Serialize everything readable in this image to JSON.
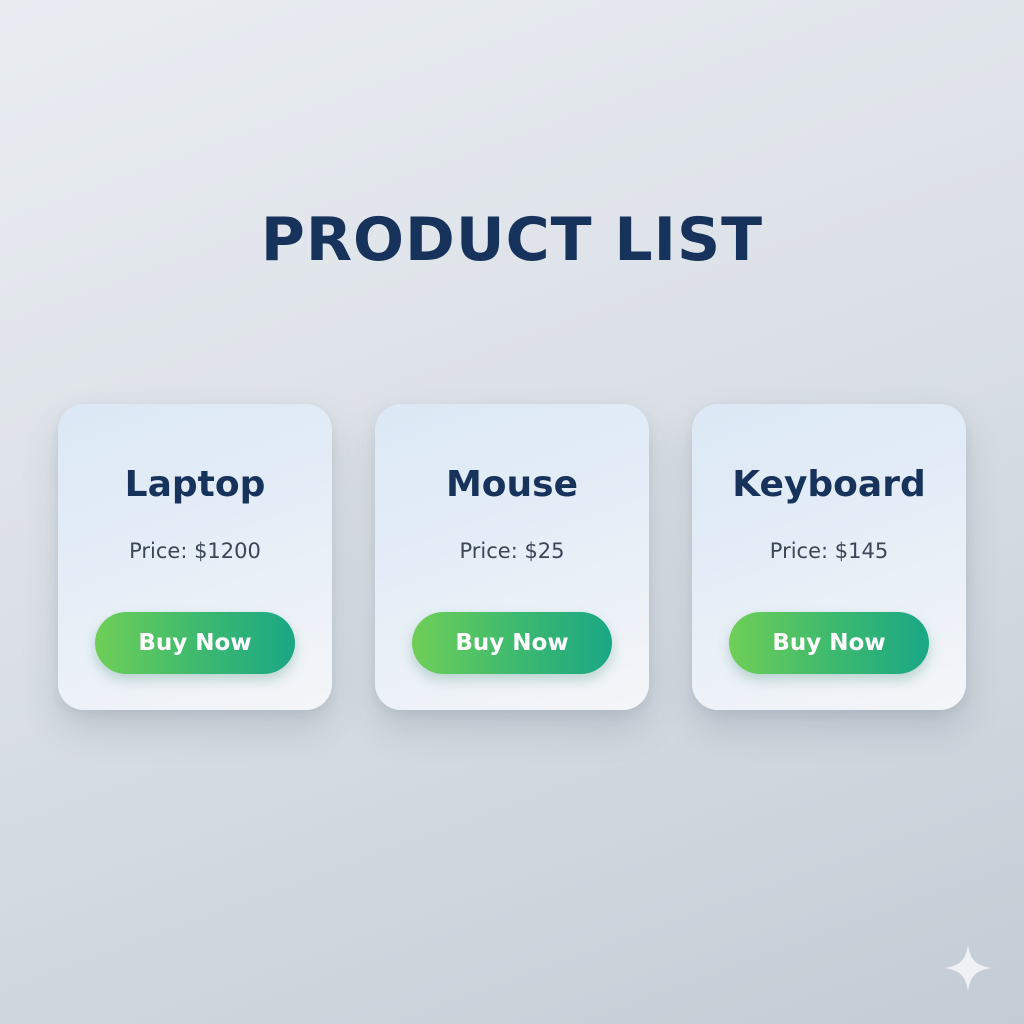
{
  "page": {
    "title": "PRODUCT LIST"
  },
  "colors": {
    "title": "#17325b",
    "button_start": "#6fcf57",
    "button_end": "#1aa785",
    "card_background": "#e6eef7"
  },
  "products": [
    {
      "name": "Laptop",
      "price": "Price: $1200",
      "button_label": "Buy Now"
    },
    {
      "name": "Mouse",
      "price": "Price: $25",
      "button_label": "Buy Now"
    },
    {
      "name": "Keyboard",
      "price": "Price: $145",
      "button_label": "Buy Now"
    }
  ],
  "decoration": {
    "corner_icon": "sparkle-icon"
  }
}
